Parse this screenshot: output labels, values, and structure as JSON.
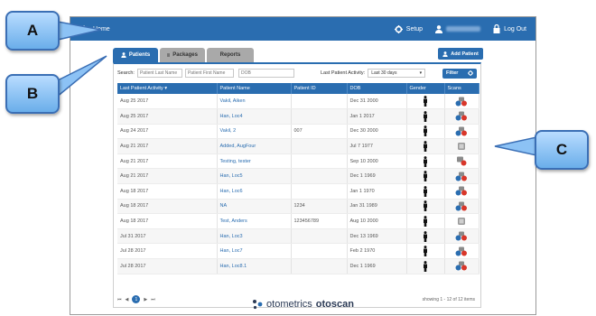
{
  "callouts": [
    "A",
    "B",
    "C"
  ],
  "topbar": {
    "home_label": "Home",
    "setup_label": "Setup",
    "logout_label": "Log Out",
    "bg_color": "#2a6db0"
  },
  "tabs": [
    {
      "label": "Patients",
      "icon": "user-icon",
      "active": true
    },
    {
      "label": "Packages",
      "icon": "list-icon",
      "active": false
    },
    {
      "label": "Reports",
      "icon": "",
      "active": false
    }
  ],
  "add_patient_label": "Add Patient",
  "search": {
    "label": "Search:",
    "last_name_placeholder": "Patient Last Name",
    "first_name_placeholder": "Patient First Name",
    "dob_placeholder": "DOB",
    "activity_label": "Last Patient Activity:",
    "activity_value": "Last 30 days",
    "filter_label": "Filter"
  },
  "table": {
    "columns": [
      "Last Patient Activity ▾",
      "Patient Name",
      "Patient ID",
      "DOB",
      "Gender",
      "Scans"
    ],
    "rows": [
      {
        "activity": "Aug 25 2017",
        "name": "Vakil, Aiken",
        "id": "",
        "dob": "Dec 31 2000",
        "scan": "multi"
      },
      {
        "activity": "Aug 25 2017",
        "name": "Han, Loc4",
        "id": "",
        "dob": "Jan 1 2017",
        "scan": "multi"
      },
      {
        "activity": "Aug 24 2017",
        "name": "Vakil, 2",
        "id": "007",
        "dob": "Dec 30 2000",
        "scan": "multi"
      },
      {
        "activity": "Aug 21 2017",
        "name": "Added, AugFour",
        "id": "",
        "dob": "Jul 7 1977",
        "scan": "single"
      },
      {
        "activity": "Aug 21 2017",
        "name": "Testing, tester",
        "id": "",
        "dob": "Sep 10 2000",
        "scan": "red"
      },
      {
        "activity": "Aug 21 2017",
        "name": "Han, Loc5",
        "id": "",
        "dob": "Dec 1 1969",
        "scan": "multi"
      },
      {
        "activity": "Aug 18 2017",
        "name": "Han, Loc6",
        "id": "",
        "dob": "Jan 1 1970",
        "scan": "multi"
      },
      {
        "activity": "Aug 18 2017",
        "name": "NA",
        "id": "1234",
        "dob": "Jan 31 1989",
        "scan": "multi"
      },
      {
        "activity": "Aug 18 2017",
        "name": "Test, Anders",
        "id": "123456789",
        "dob": "Aug 10 2000",
        "scan": "single"
      },
      {
        "activity": "Jul 31 2017",
        "name": "Han, Loc3",
        "id": "",
        "dob": "Dec 13 1969",
        "scan": "multi"
      },
      {
        "activity": "Jul 28 2017",
        "name": "Han, Loc7",
        "id": "",
        "dob": "Feb 2 1970",
        "scan": "multi"
      },
      {
        "activity": "Jul 28 2017",
        "name": "Han, Loc8.1",
        "id": "",
        "dob": "Dec 1 1969",
        "scan": "multi"
      }
    ]
  },
  "pager": {
    "first": "⏮",
    "prev": "◀",
    "current": "1",
    "next": "▶",
    "last": "⏭"
  },
  "showing_text": "showing 1 - 12 of 12 items",
  "footer": {
    "brand": "otometrics",
    "product": "otoscan"
  }
}
